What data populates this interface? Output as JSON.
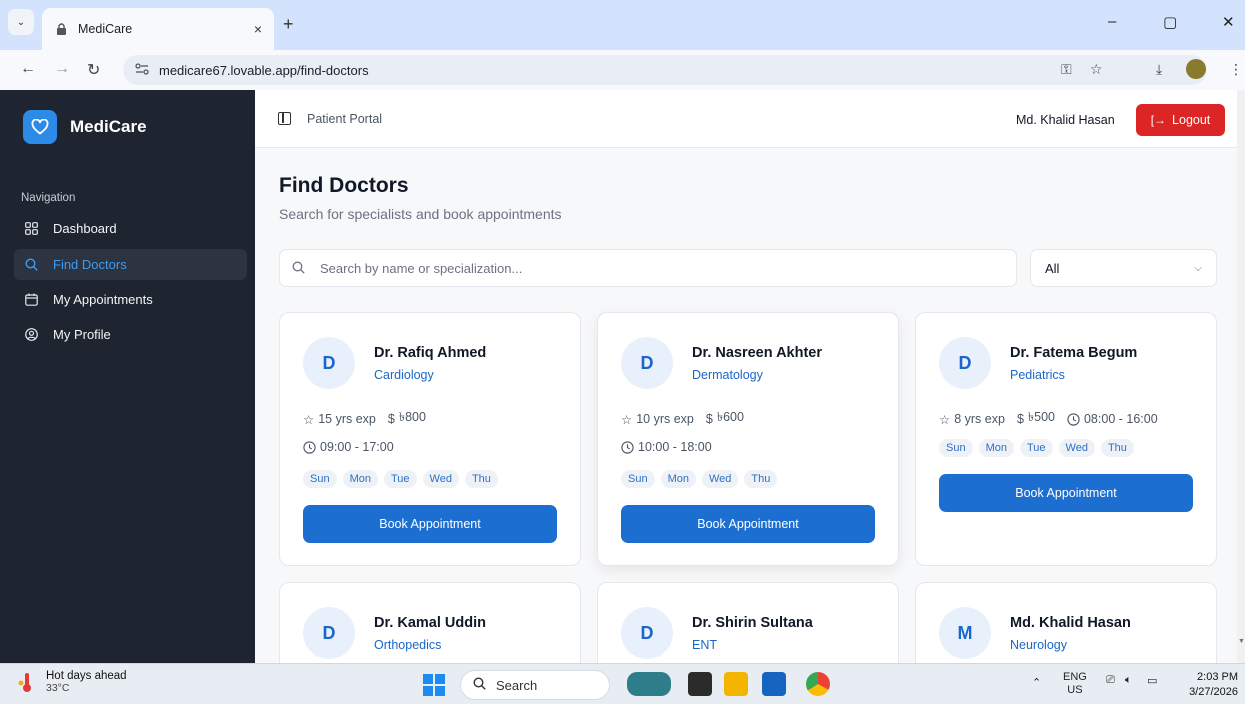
{
  "browser": {
    "tab_title": "MediCare",
    "tab_close": "×",
    "new_tab": "+",
    "url": "medicare67.lovable.app/find-doctors",
    "win_min": "–",
    "win_max": "▢",
    "win_close": "✕"
  },
  "sidebar": {
    "brand": "MediCare",
    "nav_heading": "Navigation",
    "items": [
      {
        "label": "Dashboard",
        "icon": "grid-icon",
        "active": false
      },
      {
        "label": "Find Doctors",
        "icon": "search-icon",
        "active": true
      },
      {
        "label": "My Appointments",
        "icon": "calendar-icon",
        "active": false
      },
      {
        "label": "My Profile",
        "icon": "user-circle-icon",
        "active": false
      }
    ]
  },
  "header": {
    "portal_label": "Patient Portal",
    "user_name": "Md. Khalid Hasan",
    "logout_label": "Logout"
  },
  "page": {
    "title": "Find Doctors",
    "subtitle": "Search for specialists and book appointments",
    "search_placeholder": "Search by name or specialization...",
    "filter_value": "All"
  },
  "doctors": [
    {
      "initial": "D",
      "name": "Dr. Rafiq Ahmed",
      "specialty": "Cardiology",
      "experience": "15 yrs exp",
      "fee": "৳800",
      "hours": "09:00 - 17:00",
      "days": [
        "Sun",
        "Mon",
        "Tue",
        "Wed",
        "Thu"
      ],
      "book_label": "Book Appointment"
    },
    {
      "initial": "D",
      "name": "Dr. Nasreen Akhter",
      "specialty": "Dermatology",
      "experience": "10 yrs exp",
      "fee": "৳600",
      "hours": "10:00 - 18:00",
      "days": [
        "Sun",
        "Mon",
        "Wed",
        "Thu"
      ],
      "book_label": "Book Appointment"
    },
    {
      "initial": "D",
      "name": "Dr. Fatema Begum",
      "specialty": "Pediatrics",
      "experience": "8 yrs exp",
      "fee": "৳500",
      "hours": "08:00 - 16:00",
      "days": [
        "Sun",
        "Mon",
        "Tue",
        "Wed",
        "Thu"
      ],
      "book_label": "Book Appointment"
    },
    {
      "initial": "D",
      "name": "Dr. Kamal Uddin",
      "specialty": "Orthopedics"
    },
    {
      "initial": "D",
      "name": "Dr. Shirin Sultana",
      "specialty": "ENT"
    },
    {
      "initial": "M",
      "name": "Md. Khalid Hasan",
      "specialty": "Neurology"
    }
  ],
  "taskbar": {
    "weather_title": "Hot days ahead",
    "weather_temp": "33°C",
    "search_label": "Search",
    "lang_top": "ENG",
    "lang_bottom": "US",
    "time": "2:03 PM",
    "date": "3/27/2026"
  },
  "colors": {
    "sidebar_bg": "#1e2530",
    "accent": "#1c6fd1",
    "logout": "#dc2626"
  }
}
